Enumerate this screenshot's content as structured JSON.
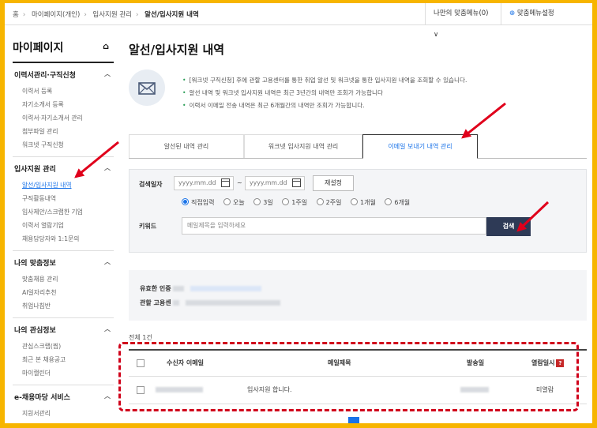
{
  "breadcrumb": [
    "홈",
    "마이페이지(개인)",
    "입사지원 관리",
    "알선/입사지원 내역"
  ],
  "topbar": {
    "my_menu": "나만의 맞춤메뉴(0)",
    "my_menu_setting": "맞춤메뉴설정"
  },
  "sidebar": {
    "title": "마이페이지",
    "sections": [
      {
        "title": "이력서관리·구직신청",
        "items": [
          "이력서 등록",
          "자기소개서 등록",
          "이력서·자기소개서 관리",
          "첨부파일 관리",
          "워크넷 구직신청"
        ]
      },
      {
        "title": "입사지원 관리",
        "items": [
          "알선/입사지원 내역",
          "구직활동내역",
          "입사제안/스크랩한 기업",
          "이력서 열람기업",
          "채용담당자와 1:1문의"
        ]
      },
      {
        "title": "나의 맞춤정보",
        "items": [
          "맞춤채용 관리",
          "AI일자리추천",
          "취업나침반"
        ]
      },
      {
        "title": "나의 관심정보",
        "items": [
          "관심스크랩(찜)",
          "최근 본 채용공고",
          "마이캘린더"
        ]
      },
      {
        "title": "e-채용마당 서비스",
        "items": [
          "지원서관리"
        ]
      }
    ]
  },
  "main": {
    "title": "알선/입사지원 내역",
    "notes": [
      "[워크넷 구직신청] 후에 관할 고용센터를 통한 취업 알선 및 워크넷을 통한 입사지원 내역을 조회할 수 있습니다.",
      "알선 내역 및 워크넷 입사지원 내역은 최근 3년간의 내역만 조회가 가능합니다",
      "이력서 이메일 전송 내역은 최근 6개월간의 내역만 조회가 가능합니다."
    ],
    "tabs": [
      "알선된 내역 관리",
      "워크넷 입사지원 내역 관리",
      "이메일 보내기 내역 관리"
    ],
    "active_tab": 2
  },
  "search": {
    "date_label": "검색일자",
    "date_placeholder_start": "yyyy.mm.dd",
    "date_placeholder_end": "yyyy.mm.dd",
    "date_sep": "~",
    "reset": "재설정",
    "periods": [
      "직접입력",
      "오늘",
      "3일",
      "1주일",
      "2주일",
      "1개월",
      "6개월"
    ],
    "selected_period": "직접입력",
    "keyword_label": "키워드",
    "keyword_placeholder": "메일제목을 입력하세요",
    "search_button": "검색"
  },
  "cert": {
    "line1": "유효한 인증",
    "line2": "관할 고용센"
  },
  "results": {
    "count_text": "전체 1건",
    "columns": [
      "수신자 이메일",
      "메일제목",
      "발송일",
      "열람일시"
    ],
    "help_icon": "?",
    "rows": [
      {
        "email": "",
        "subject": "입사지원 합니다.",
        "sent": "",
        "read": "미열람"
      }
    ]
  },
  "colors": {
    "accent": "#1a73e8",
    "annotation": "#d0021b",
    "frame": "#f7b500",
    "search_button": "#2e3a56"
  }
}
